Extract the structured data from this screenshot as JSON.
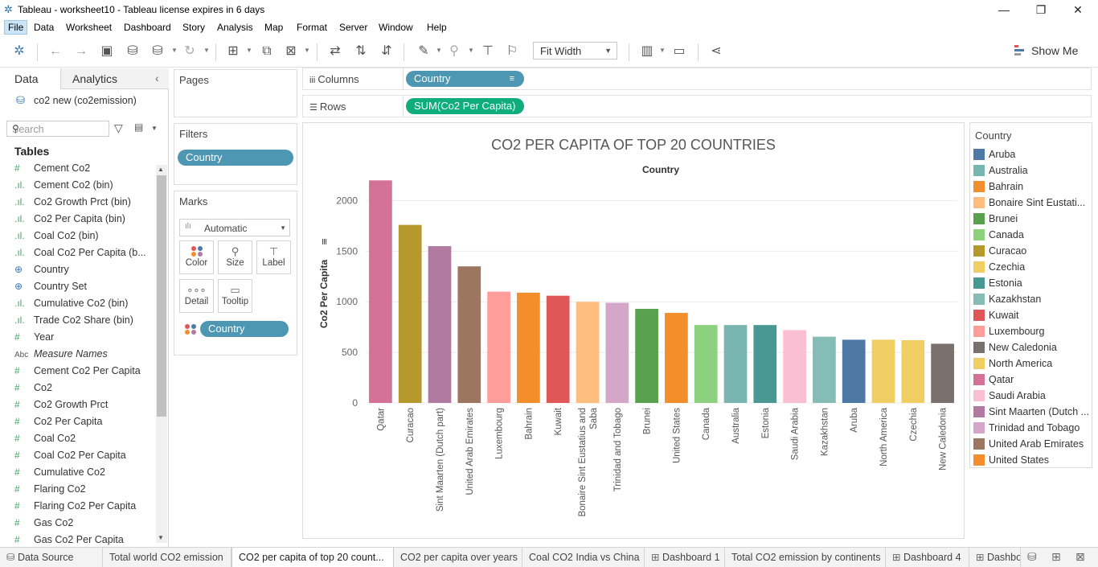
{
  "window": {
    "title": "Tableau - worksheet10 - Tableau license expires in 6 days"
  },
  "menu": [
    "File",
    "Data",
    "Worksheet",
    "Dashboard",
    "Story",
    "Analysis",
    "Map",
    "Format",
    "Server",
    "Window",
    "Help"
  ],
  "toolbar": {
    "fit_label": "Fit Width",
    "show_me_label": "Show Me"
  },
  "left_panel": {
    "tabs": [
      "Data",
      "Analytics"
    ],
    "datasource": "co2 new (co2emission)",
    "search_placeholder": "Search",
    "tables_heading": "Tables",
    "fields": [
      {
        "icon": "#",
        "name": "Cement Co2"
      },
      {
        "icon": ".ıl.",
        "name": "Cement Co2 (bin)"
      },
      {
        "icon": ".ıl.",
        "name": "Co2 Growth Prct (bin)"
      },
      {
        "icon": ".ıl.",
        "name": "Co2 Per Capita (bin)"
      },
      {
        "icon": ".ıl.",
        "name": "Coal Co2 (bin)"
      },
      {
        "icon": ".ıl.",
        "name": "Coal Co2 Per Capita (b..."
      },
      {
        "icon": "⊕",
        "name": "Country"
      },
      {
        "icon": "⊕",
        "name": "Country Set"
      },
      {
        "icon": ".ıl.",
        "name": "Cumulative Co2 (bin)"
      },
      {
        "icon": ".ıl.",
        "name": "Trade Co2 Share (bin)"
      },
      {
        "icon": "#",
        "name": "Year"
      },
      {
        "icon": "Abc",
        "name": "Measure Names"
      },
      {
        "icon": "#",
        "name": "Cement Co2 Per Capita"
      },
      {
        "icon": "#",
        "name": "Co2"
      },
      {
        "icon": "#",
        "name": "Co2 Growth Prct"
      },
      {
        "icon": "#",
        "name": "Co2 Per Capita"
      },
      {
        "icon": "#",
        "name": "Coal Co2"
      },
      {
        "icon": "#",
        "name": "Coal Co2 Per Capita"
      },
      {
        "icon": "#",
        "name": "Cumulative Co2"
      },
      {
        "icon": "#",
        "name": "Flaring Co2"
      },
      {
        "icon": "#",
        "name": "Flaring Co2 Per Capita"
      },
      {
        "icon": "#",
        "name": "Gas Co2"
      },
      {
        "icon": "#",
        "name": "Gas Co2 Per Capita"
      }
    ]
  },
  "pages": {
    "title": "Pages"
  },
  "filters": {
    "title": "Filters",
    "pill": "Country"
  },
  "marks": {
    "title": "Marks",
    "type": "Automatic",
    "buttons": [
      "Color",
      "Size",
      "Label",
      "Detail",
      "Tooltip"
    ],
    "color_pill": "Country"
  },
  "shelves": {
    "columns_label": "Columns",
    "columns_pill": "Country",
    "rows_label": "Rows",
    "rows_pill": "SUM(Co2 Per Capita)"
  },
  "chart_data": {
    "type": "bar",
    "title": "CO2 PER CAPITA OF TOP 20 COUNTRIES",
    "column_header": "Country",
    "ylabel": "Co2 Per Capita",
    "ylim": [
      0,
      2250
    ],
    "yticks": [
      0,
      500,
      1000,
      1500,
      2000
    ],
    "categories": [
      "Qatar",
      "Curacao",
      "Sint Maarten (Dutch part)",
      "United Arab Emirates",
      "Luxembourg",
      "Bahrain",
      "Kuwait",
      "Bonaire Sint Eustatius and Saba",
      "Trinidad and Tobago",
      "Brunei",
      "United States",
      "Canada",
      "Australia",
      "Estonia",
      "Saudi Arabia",
      "Kazakhstan",
      "Aruba",
      "North America",
      "Czechia",
      "New Caledonia"
    ],
    "category_labels": [
      [
        "Qatar"
      ],
      [
        "Curacao"
      ],
      [
        "Sint Maarten (Dutch part)"
      ],
      [
        "United Arab Emirates"
      ],
      [
        "Luxembourg"
      ],
      [
        "Bahrain"
      ],
      [
        "Kuwait"
      ],
      [
        "Bonaire Sint Eustatius and",
        "Saba"
      ],
      [
        "Trinidad and Tobago"
      ],
      [
        "Brunei"
      ],
      [
        "United States"
      ],
      [
        "Canada"
      ],
      [
        "Australia"
      ],
      [
        "Estonia"
      ],
      [
        "Saudi Arabia"
      ],
      [
        "Kazakhstan"
      ],
      [
        "Aruba"
      ],
      [
        "North America"
      ],
      [
        "Czechia"
      ],
      [
        "New Caledonia"
      ]
    ],
    "values": [
      2200,
      1760,
      1550,
      1350,
      1100,
      1090,
      1060,
      1000,
      990,
      930,
      890,
      770,
      770,
      770,
      720,
      655,
      625,
      625,
      620,
      585
    ],
    "colors": [
      "#d37295",
      "#b6992d",
      "#b07aa1",
      "#9d7660",
      "#ff9d9a",
      "#f28e2b",
      "#e15759",
      "#ffbe7d",
      "#d4a6c8",
      "#59a14f",
      "#f28e2b",
      "#8cd17d",
      "#79b6b2",
      "#499894",
      "#fabfd2",
      "#86bcb6",
      "#4e79a7",
      "#f1ce63",
      "#f1ce63",
      "#79706e"
    ],
    "grid": true,
    "legend": "right"
  },
  "legend": {
    "title": "Country",
    "items": [
      {
        "name": "Aruba",
        "color": "#4e79a7"
      },
      {
        "name": "Australia",
        "color": "#79b6b2"
      },
      {
        "name": "Bahrain",
        "color": "#f28e2b"
      },
      {
        "name": "Bonaire Sint Eustati...",
        "color": "#ffbe7d"
      },
      {
        "name": "Brunei",
        "color": "#59a14f"
      },
      {
        "name": "Canada",
        "color": "#8cd17d"
      },
      {
        "name": "Curacao",
        "color": "#b6992d"
      },
      {
        "name": "Czechia",
        "color": "#f1ce63"
      },
      {
        "name": "Estonia",
        "color": "#499894"
      },
      {
        "name": "Kazakhstan",
        "color": "#86bcb6"
      },
      {
        "name": "Kuwait",
        "color": "#e15759"
      },
      {
        "name": "Luxembourg",
        "color": "#ff9d9a"
      },
      {
        "name": "New Caledonia",
        "color": "#79706e"
      },
      {
        "name": "North America",
        "color": "#f1ce63"
      },
      {
        "name": "Qatar",
        "color": "#d37295"
      },
      {
        "name": "Saudi Arabia",
        "color": "#fabfd2"
      },
      {
        "name": "Sint Maarten (Dutch ...",
        "color": "#b07aa1"
      },
      {
        "name": "Trinidad and Tobago",
        "color": "#d4a6c8"
      },
      {
        "name": "United Arab Emirates",
        "color": "#9d7660"
      },
      {
        "name": "United States",
        "color": "#f28e2b"
      }
    ]
  },
  "tabs": [
    {
      "label": "Data Source",
      "icon": "datasource-icon"
    },
    {
      "label": "Total world CO2 emission"
    },
    {
      "label": "CO2 per capita of top 20 count...",
      "active": true
    },
    {
      "label": "CO2 per capita over years"
    },
    {
      "label": "Coal CO2 India vs China"
    },
    {
      "label": "Dashboard 1",
      "icon": "dashboard-icon"
    },
    {
      "label": "Total CO2 emission by continents"
    },
    {
      "label": "Dashboard 4",
      "icon": "dashboard-icon"
    },
    {
      "label": "Dashbo",
      "icon": "dashboard-icon"
    }
  ]
}
